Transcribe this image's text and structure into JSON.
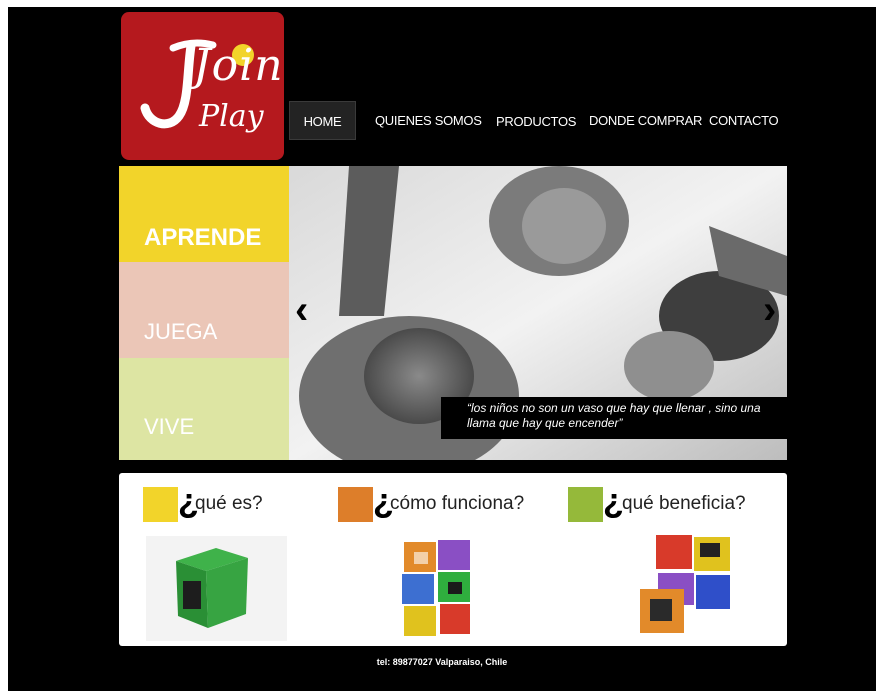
{
  "logo": {
    "line1": "Join",
    "line2": "Play"
  },
  "nav": {
    "home": "HOME",
    "quienes": "QUIENES SOMOS",
    "productos": "PRODUCTOS",
    "donde": "DONDE COMPRAR",
    "contacto": "CONTACTO"
  },
  "sidebar": {
    "aprende": "APRENDE",
    "juega": "JUEGA",
    "vive": "VIVE"
  },
  "slider": {
    "prev": "‹",
    "next": "›",
    "quote": "“los niños no son un vaso que hay que llenar , sino una llama que hay que encender”"
  },
  "features": {
    "q1_mark": "¿",
    "q1": "qué es?",
    "q2_mark": "¿",
    "q2": "cómo funciona?",
    "q3_mark": "¿",
    "q3": "qué beneficia?"
  },
  "footer": "tel: 89877027  Valparaiso, Chile",
  "colors": {
    "brand_red": "#b5191e",
    "yellow": "#f2d42a",
    "pink": "#ebc6b7",
    "green_light": "#dde5a3",
    "orange": "#dd7e2a",
    "green": "#95b93a"
  }
}
